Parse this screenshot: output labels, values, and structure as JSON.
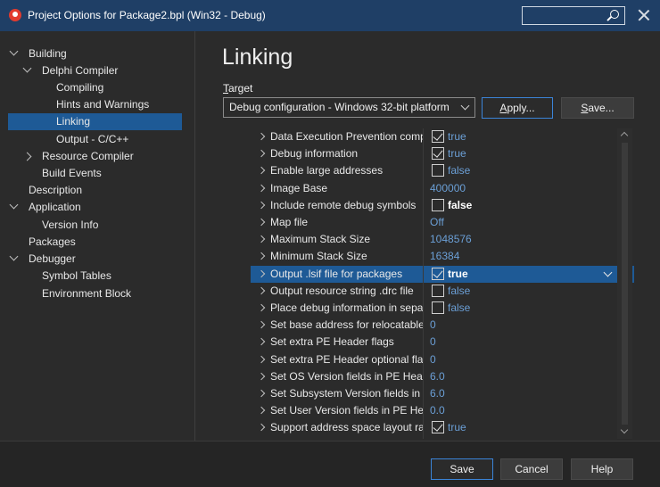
{
  "window": {
    "title": "Project Options for Package2.bpl  (Win32 - Debug)"
  },
  "tree": [
    {
      "label": "Building",
      "expander": "down"
    },
    {
      "label": "Delphi Compiler",
      "expander": "down"
    },
    {
      "label": "Compiling",
      "expander": ""
    },
    {
      "label": "Hints and Warnings",
      "expander": ""
    },
    {
      "label": "Linking",
      "expander": "",
      "selected": true
    },
    {
      "label": "Output - C/C++",
      "expander": ""
    },
    {
      "label": "Resource Compiler",
      "expander": "right"
    },
    {
      "label": "Build Events",
      "expander": ""
    },
    {
      "label": "Description",
      "expander": ""
    },
    {
      "label": "Application",
      "expander": "down"
    },
    {
      "label": "Version Info",
      "expander": ""
    },
    {
      "label": "Packages",
      "expander": ""
    },
    {
      "label": "Debugger",
      "expander": "down"
    },
    {
      "label": "Symbol Tables",
      "expander": ""
    },
    {
      "label": "Environment Block",
      "expander": ""
    }
  ],
  "main": {
    "heading": "Linking",
    "target_label": "Target",
    "target_value": "Debug configuration - Windows 32-bit platform",
    "apply_label": "Apply...",
    "save_label": "Save..."
  },
  "properties": [
    {
      "name": "Data Execution Prevention compa",
      "kind": "check",
      "checked": true,
      "value": "true"
    },
    {
      "name": "Debug information",
      "kind": "check",
      "checked": true,
      "value": "true"
    },
    {
      "name": "Enable large addresses",
      "kind": "check",
      "checked": false,
      "value": "false"
    },
    {
      "name": "Image Base",
      "kind": "text",
      "value": "400000"
    },
    {
      "name": "Include remote debug symbols",
      "kind": "check",
      "checked": false,
      "value": "false",
      "bold": true
    },
    {
      "name": "Map file",
      "kind": "text",
      "value": "Off"
    },
    {
      "name": "Maximum Stack Size",
      "kind": "text",
      "value": "1048576"
    },
    {
      "name": "Minimum Stack Size",
      "kind": "text",
      "value": "16384"
    },
    {
      "name": "Output .lsif file for packages",
      "kind": "check",
      "checked": true,
      "value": "true",
      "selected": true
    },
    {
      "name": "Output resource string .drc file",
      "kind": "check",
      "checked": false,
      "value": "false"
    },
    {
      "name": "Place debug information in separa",
      "kind": "check",
      "checked": false,
      "value": "false"
    },
    {
      "name": "Set base address for relocatable in",
      "kind": "text",
      "value": "0"
    },
    {
      "name": "Set extra PE Header flags",
      "kind": "text",
      "value": "0"
    },
    {
      "name": "Set extra PE Header optional flags",
      "kind": "text",
      "value": "0"
    },
    {
      "name": "Set OS Version fields in PE Header",
      "kind": "text",
      "value": "6.0"
    },
    {
      "name": "Set Subsystem Version fields in PE",
      "kind": "text",
      "value": "6.0"
    },
    {
      "name": "Set User Version fields in PE Heade",
      "kind": "text",
      "value": "0.0"
    },
    {
      "name": "Support address space layout rand",
      "kind": "check",
      "checked": true,
      "value": "true"
    }
  ],
  "footer": {
    "save": "Save",
    "cancel": "Cancel",
    "help": "Help"
  },
  "colors": {
    "titlebar": "#1f3f66",
    "selection": "#1e5a96",
    "value_text": "#6b9fd6",
    "accent_border": "#3b84d8"
  }
}
